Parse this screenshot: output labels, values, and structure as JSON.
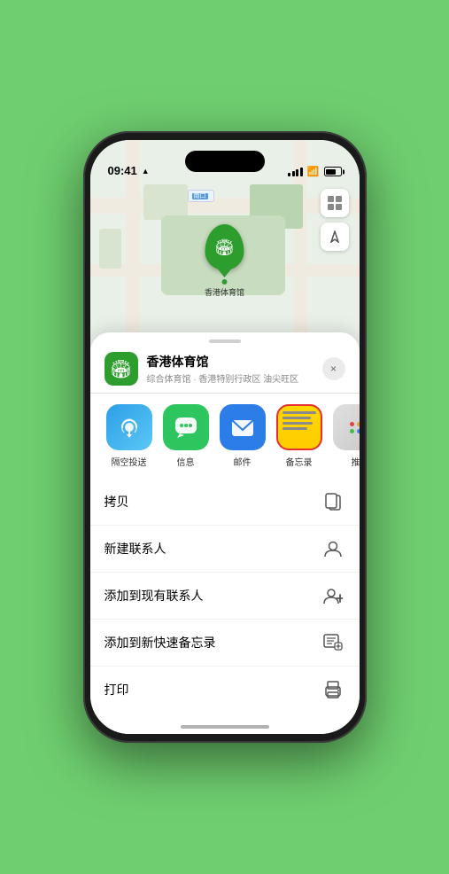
{
  "status_bar": {
    "time": "09:41",
    "location_arrow": "▶"
  },
  "map": {
    "label": "南口",
    "venue_name": "香港体育馆"
  },
  "venue_card": {
    "title": "香港体育馆",
    "subtitle": "综合体育馆 · 香港特别行政区 油尖旺区",
    "close_label": "×"
  },
  "share_items": [
    {
      "id": "airdrop",
      "label": "隔空投送"
    },
    {
      "id": "messages",
      "label": "信息"
    },
    {
      "id": "mail",
      "label": "邮件"
    },
    {
      "id": "notes",
      "label": "备忘录"
    },
    {
      "id": "more",
      "label": "推"
    }
  ],
  "actions": [
    {
      "label": "拷贝",
      "icon": "copy"
    },
    {
      "label": "新建联系人",
      "icon": "person"
    },
    {
      "label": "添加到现有联系人",
      "icon": "person_add"
    },
    {
      "label": "添加到新快速备忘录",
      "icon": "note"
    },
    {
      "label": "打印",
      "icon": "print"
    }
  ]
}
